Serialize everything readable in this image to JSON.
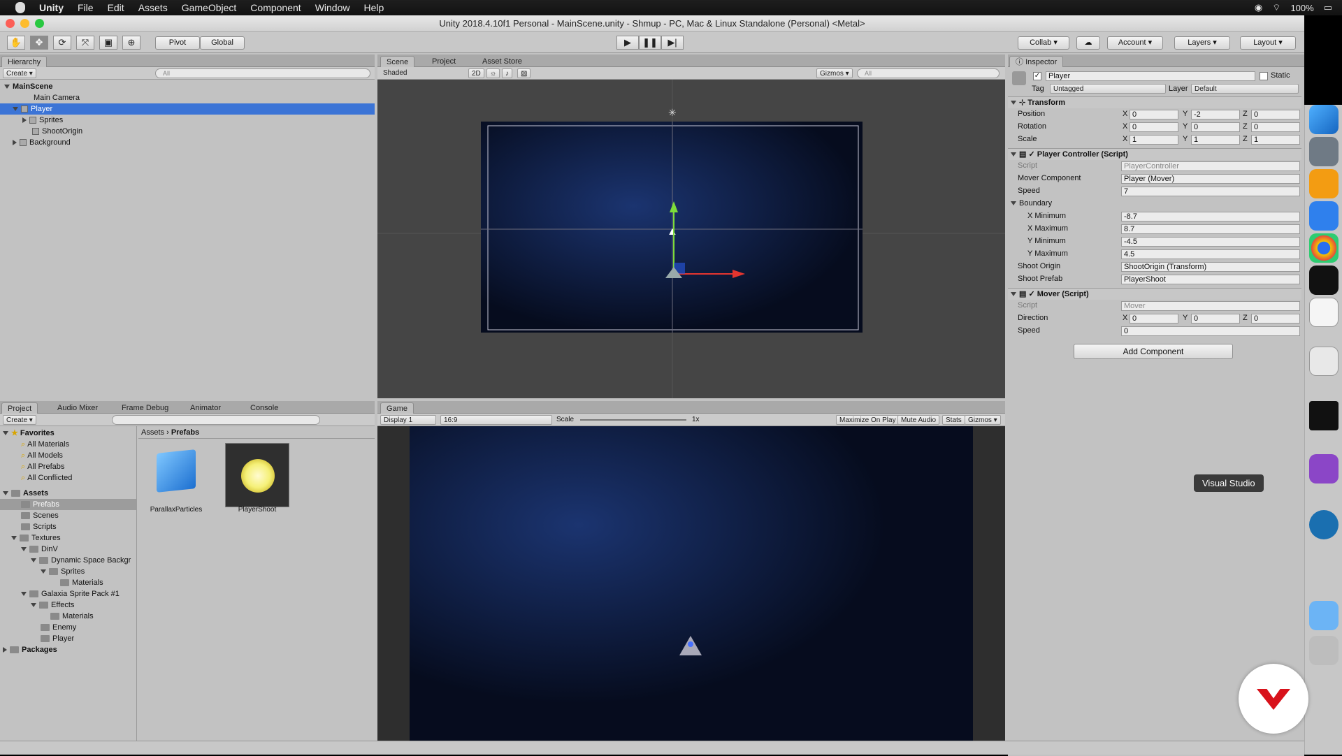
{
  "menubar": {
    "items": [
      "Unity",
      "File",
      "Edit",
      "Assets",
      "GameObject",
      "Component",
      "Window",
      "Help"
    ],
    "battery": "100%"
  },
  "window": {
    "title": "Unity 2018.4.10f1 Personal - MainScene.unity - Shmup - PC, Mac & Linux Standalone (Personal) <Metal>"
  },
  "toolbar": {
    "pivot": "Pivot",
    "global": "Global",
    "collab": "Collab ▾",
    "account": "Account ▾",
    "layers": "Layers ▾",
    "layout": "Layout ▾"
  },
  "hierarchy": {
    "tab": "Hierarchy",
    "create": "Create ▾",
    "search_placeholder": "All",
    "scene": "MainScene",
    "items": [
      "Main Camera",
      "Player",
      "Sprites",
      "ShootOrigin",
      "Background"
    ]
  },
  "scene_panel": {
    "tabs": [
      "Scene",
      "Project",
      "Asset Store"
    ],
    "shaded": "Shaded",
    "mode2d": "2D",
    "gizmos": "Gizmos ▾",
    "search": "All"
  },
  "game_panel": {
    "tab": "Game",
    "display": "Display 1",
    "aspect": "16:9",
    "scale_label": "Scale",
    "scale_value": "1x",
    "maximize": "Maximize On Play",
    "mute": "Mute Audio",
    "stats": "Stats",
    "gizmos": "Gizmos ▾"
  },
  "project": {
    "tabs": [
      "Project",
      "Audio Mixer",
      "Frame Debug",
      "Animator",
      "Console"
    ],
    "create": "Create ▾",
    "breadcrumb": [
      "Assets",
      "Prefabs"
    ],
    "favorites_label": "Favorites",
    "favorites": [
      "All Materials",
      "All Models",
      "All Prefabs",
      "All Conflicted"
    ],
    "assets_label": "Assets",
    "tree": [
      "Prefabs",
      "Scenes",
      "Scripts",
      "Textures",
      "DinV",
      "Dynamic Space Backgr",
      "Sprites",
      "Materials",
      "Galaxia Sprite Pack #1",
      "Effects",
      "Materials",
      "Enemy",
      "Player"
    ],
    "packages": "Packages",
    "files": [
      {
        "name": "ParallaxParticles"
      },
      {
        "name": "PlayerShoot"
      }
    ]
  },
  "inspector": {
    "tab": "Inspector",
    "object_name": "Player",
    "static": "Static",
    "tag_label": "Tag",
    "tag": "Untagged",
    "layer_label": "Layer",
    "layer": "Default",
    "transform": {
      "title": "Transform",
      "rows": [
        {
          "label": "Position",
          "x": "0",
          "y": "-2",
          "z": "0"
        },
        {
          "label": "Rotation",
          "x": "0",
          "y": "0",
          "z": "0"
        },
        {
          "label": "Scale",
          "x": "1",
          "y": "1",
          "z": "1"
        }
      ]
    },
    "player_controller": {
      "title": "Player Controller (Script)",
      "rows": [
        {
          "label": "Script",
          "value": "PlayerController"
        },
        {
          "label": "Mover Component",
          "value": "Player (Mover)"
        },
        {
          "label": "Speed",
          "value": "7"
        },
        {
          "label": "Boundary",
          "value": ""
        },
        {
          "label": "X Minimum",
          "value": "-8.7"
        },
        {
          "label": "X Maximum",
          "value": "8.7"
        },
        {
          "label": "Y Minimum",
          "value": "-4.5"
        },
        {
          "label": "Y Maximum",
          "value": "4.5"
        },
        {
          "label": "Shoot Origin",
          "value": "ShootOrigin (Transform)"
        },
        {
          "label": "Shoot Prefab",
          "value": "PlayerShoot"
        }
      ]
    },
    "mover": {
      "title": "Mover (Script)",
      "script_label": "Script",
      "script": "Mover",
      "direction_label": "Direction",
      "dx": "0",
      "dy": "0",
      "dz": "0",
      "speed_label": "Speed",
      "speed": "0"
    },
    "add_component": "Add Component"
  },
  "axis": {
    "x": "X",
    "y": "Y",
    "z": "Z"
  },
  "dock": {
    "tooltip": "Visual Studio"
  },
  "colors": {
    "selection": "#3b74d6",
    "space": "#0b1630"
  }
}
